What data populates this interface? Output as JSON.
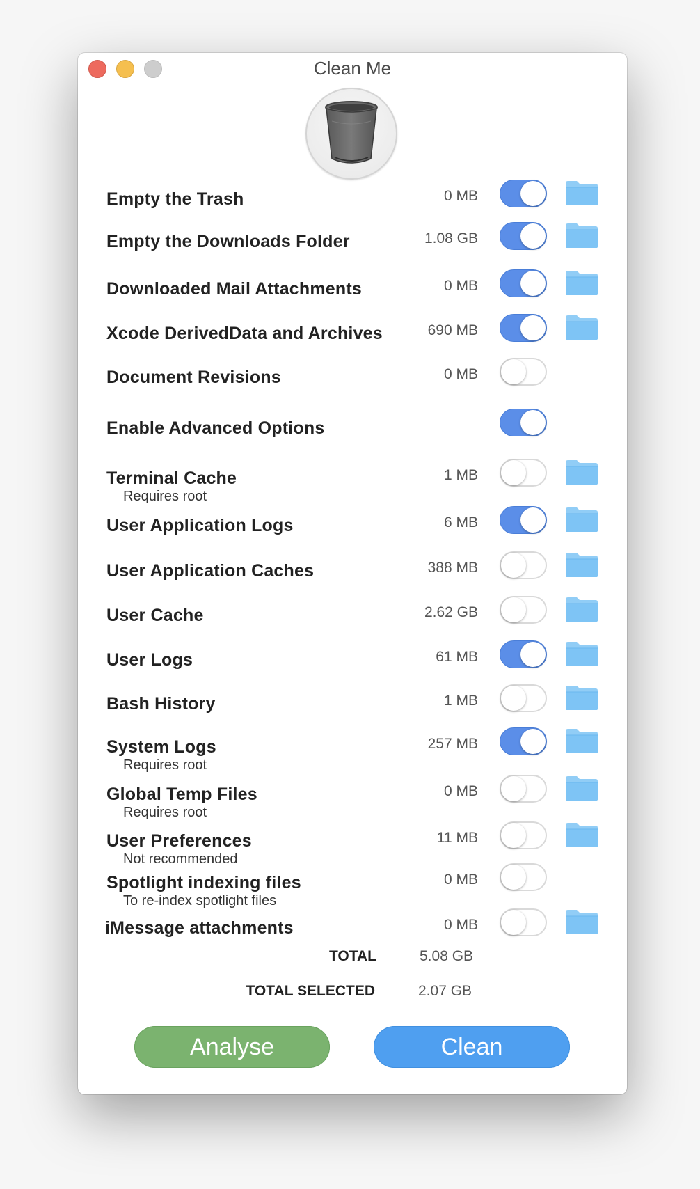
{
  "window": {
    "title": "Clean Me"
  },
  "colors": {
    "toggle_on": "#5b8ee8",
    "folder": "#7ec4f5",
    "analyse_button": "#7bb36f",
    "clean_button": "#4f9ff0"
  },
  "items": [
    {
      "label": "Empty the Trash",
      "sublabel": "",
      "size": "0 MB",
      "enabled": true,
      "folder": true
    },
    {
      "label": "Empty the Downloads Folder",
      "sublabel": "",
      "size": "1.08 GB",
      "enabled": true,
      "folder": true
    },
    {
      "label": "Downloaded Mail Attachments",
      "sublabel": "",
      "size": "0 MB",
      "enabled": true,
      "folder": true
    },
    {
      "label": "Xcode DerivedData and Archives",
      "sublabel": "",
      "size": "690 MB",
      "enabled": true,
      "folder": true
    },
    {
      "label": "Document Revisions",
      "sublabel": "",
      "size": "0 MB",
      "enabled": false,
      "folder": false
    },
    {
      "label": "Enable Advanced Options",
      "sublabel": "",
      "size": "",
      "enabled": true,
      "folder": false
    },
    {
      "label": "Terminal Cache",
      "sublabel": "Requires root",
      "size": "1 MB",
      "enabled": false,
      "folder": true
    },
    {
      "label": "User Application Logs",
      "sublabel": "",
      "size": "6 MB",
      "enabled": true,
      "folder": true
    },
    {
      "label": "User Application Caches",
      "sublabel": "",
      "size": "388 MB",
      "enabled": false,
      "folder": true
    },
    {
      "label": "User Cache",
      "sublabel": "",
      "size": "2.62 GB",
      "enabled": false,
      "folder": true
    },
    {
      "label": "User Logs",
      "sublabel": "",
      "size": "61 MB",
      "enabled": true,
      "folder": true
    },
    {
      "label": "Bash History",
      "sublabel": "",
      "size": "1 MB",
      "enabled": false,
      "folder": true
    },
    {
      "label": "System Logs",
      "sublabel": "Requires root",
      "size": "257 MB",
      "enabled": true,
      "folder": true
    },
    {
      "label": "Global Temp Files",
      "sublabel": "Requires root",
      "size": "0 MB",
      "enabled": false,
      "folder": true
    },
    {
      "label": "User Preferences",
      "sublabel": "Not recommended",
      "size": "11 MB",
      "enabled": false,
      "folder": true
    },
    {
      "label": "Spotlight indexing files",
      "sublabel": "To re-index spotlight files",
      "size": "0 MB",
      "enabled": false,
      "folder": false
    },
    {
      "label": "iMessage attachments",
      "sublabel": "",
      "size": "0 MB",
      "enabled": false,
      "folder": true
    }
  ],
  "totals": {
    "total_label": "TOTAL",
    "total_value": "5.08 GB",
    "selected_label": "TOTAL SELECTED",
    "selected_value": "2.07 GB"
  },
  "buttons": {
    "analyse": "Analyse",
    "clean": "Clean"
  }
}
